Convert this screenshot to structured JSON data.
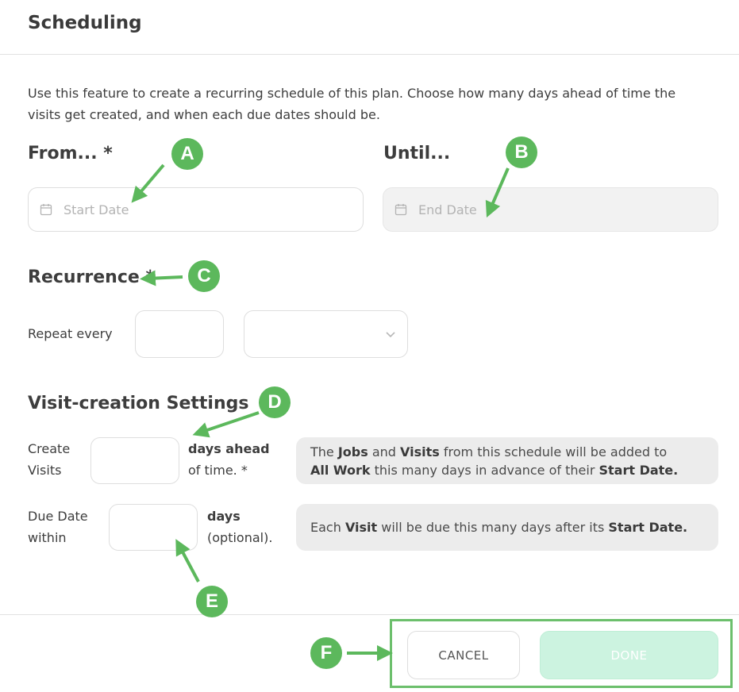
{
  "header": {
    "title": "Scheduling"
  },
  "description": "Use this feature to create a recurring schedule of this plan. Choose how many days ahead of time the visits get created, and when each due dates should be.",
  "from": {
    "label": "From... *",
    "placeholder": "Start Date"
  },
  "until": {
    "label": "Until...",
    "placeholder": "End Date"
  },
  "recurrence": {
    "title": "Recurrence *",
    "repeat_label": "Repeat every",
    "interval_value": "",
    "unit_value": ""
  },
  "visit_settings": {
    "title": "Visit-creation Settings",
    "create_label_1": "Create",
    "create_label_2": "Visits",
    "create_suffix_1": "days ahead",
    "create_suffix_2": "of time. *",
    "create_info": {
      "t1": "The ",
      "b1": "Jobs",
      "t2": " and ",
      "b2": "Visits",
      "t3": " from this schedule will be added to",
      "b3": "All Work",
      "t4": " this many days in advance of their ",
      "b4": "Start Date."
    },
    "due_label_1": "Due Date",
    "due_label_2": "within",
    "due_suffix_1": "days",
    "due_suffix_2": "(optional).",
    "due_info": {
      "t1": "Each ",
      "b1": "Visit",
      "t2": " will be due this many days after its ",
      "b2": "Start Date."
    }
  },
  "footer": {
    "cancel_label": "CANCEL",
    "done_label": "DONE"
  },
  "annotations": {
    "a": "A",
    "b": "B",
    "c": "C",
    "d": "D",
    "e": "E",
    "f": "F"
  },
  "colors": {
    "annotation_green": "#5cb85c",
    "done_bg": "#ccf3e0"
  }
}
